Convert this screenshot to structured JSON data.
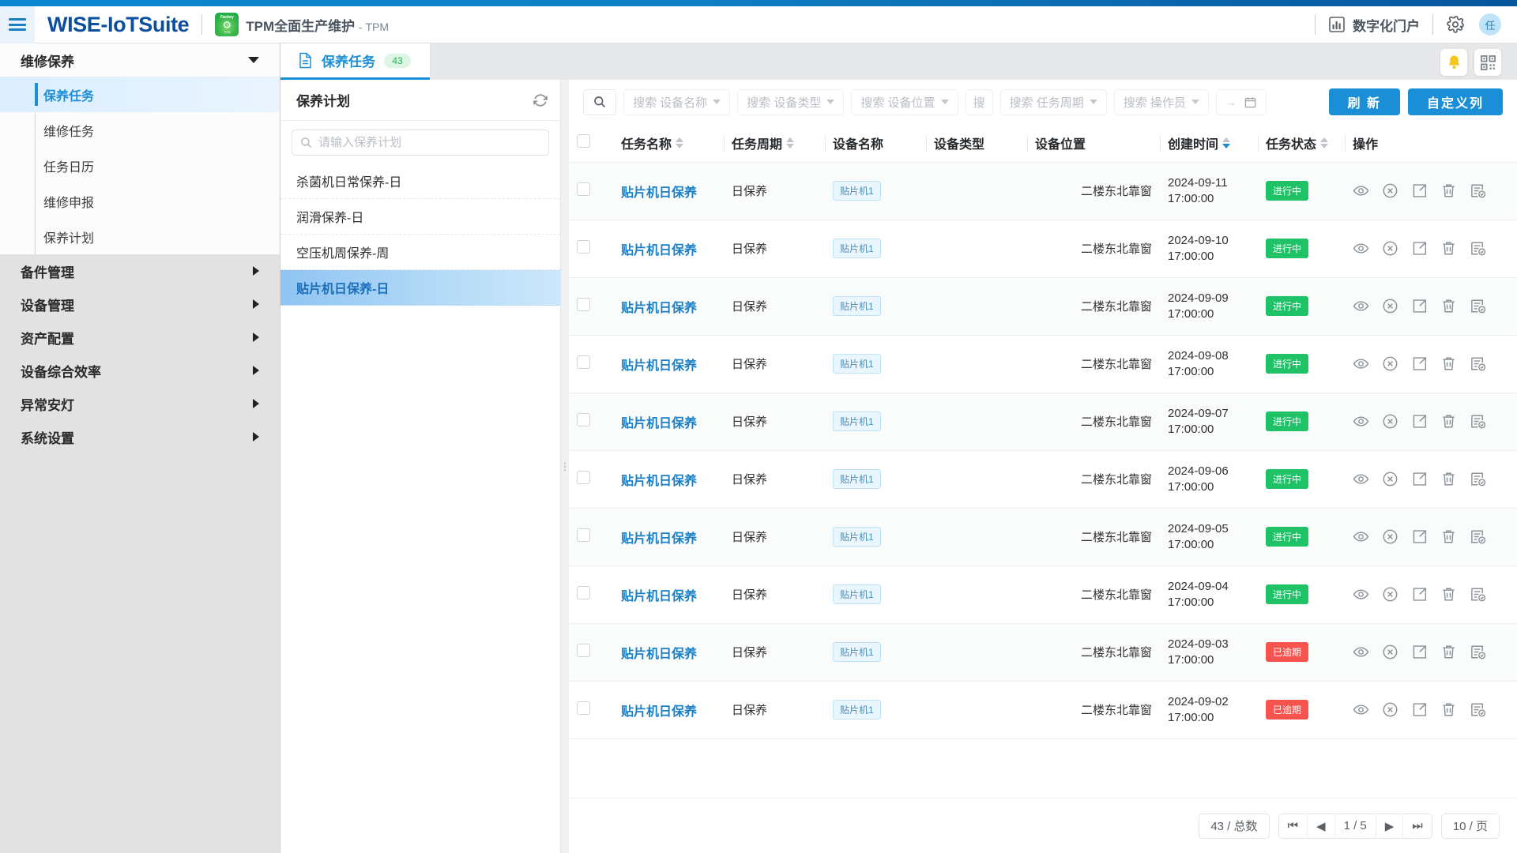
{
  "header": {
    "menu_icon": "hamburger-icon",
    "brand": "WISE-IoTSuite",
    "app_logo_top": "Factory",
    "app_logo_bottom": "TPM",
    "app_title": "TPM全面生产维护",
    "app_title_suffix": "- TPM",
    "portal_label": "数字化门户",
    "portal_icon": "chart-icon",
    "settings_icon": "gear-icon",
    "avatar_text": "任"
  },
  "sidebar": {
    "groups": [
      {
        "label": "维修保养",
        "expanded": true,
        "items": [
          {
            "label": "保养任务",
            "active": true
          },
          {
            "label": "维修任务",
            "active": false
          },
          {
            "label": "任务日历",
            "active": false
          },
          {
            "label": "维修申报",
            "active": false
          },
          {
            "label": "保养计划",
            "active": false
          }
        ]
      },
      {
        "label": "备件管理",
        "expanded": false,
        "items": []
      },
      {
        "label": "设备管理",
        "expanded": false,
        "items": []
      },
      {
        "label": "资产配置",
        "expanded": false,
        "items": []
      },
      {
        "label": "设备综合效率",
        "expanded": false,
        "items": []
      },
      {
        "label": "异常安灯",
        "expanded": false,
        "items": []
      },
      {
        "label": "系统设置",
        "expanded": false,
        "items": []
      }
    ]
  },
  "tabbar": {
    "tab_icon": "document-icon",
    "tab_label": "保养任务",
    "tab_badge": "43",
    "bell_icon": "bell-icon",
    "qr_icon": "qrcode-icon"
  },
  "plan_pane": {
    "title": "保养计划",
    "refresh_icon": "refresh-icon",
    "more_icon": "more-vertical-icon",
    "search_icon": "search-icon",
    "search_placeholder": "请输入保养计划",
    "search_value": "",
    "items": [
      {
        "label": "杀菌机日常保养-日",
        "active": false
      },
      {
        "label": "润滑保养-日",
        "active": false
      },
      {
        "label": "空压机周保养-周",
        "active": false
      },
      {
        "label": "贴片机日保养-日",
        "active": true
      }
    ]
  },
  "toolbar": {
    "search_icon": "search-icon",
    "filters": [
      {
        "label": "搜索 设备名称",
        "truncated": false
      },
      {
        "label": "搜索 设备类型",
        "truncated": false
      },
      {
        "label": "搜索 设备位置",
        "truncated": false
      },
      {
        "label": "搜",
        "truncated": true
      },
      {
        "label": "搜索 任务周期",
        "truncated": false
      },
      {
        "label": "搜索 操作员",
        "truncated": false
      }
    ],
    "daterange_icon": "calendar-icon",
    "daterange_separator": "→",
    "refresh_label": "刷 新",
    "custom_columns_label": "自定义列"
  },
  "table": {
    "select_all_checkbox": false,
    "columns": [
      {
        "label": "任务名称",
        "sortable": true,
        "sort": "none"
      },
      {
        "label": "任务周期",
        "sortable": true,
        "sort": "none"
      },
      {
        "label": "设备名称",
        "sortable": false,
        "sort": "none"
      },
      {
        "label": "设备类型",
        "sortable": false,
        "sort": "none"
      },
      {
        "label": "设备位置",
        "sortable": false,
        "sort": "none"
      },
      {
        "label": "创建时间",
        "sortable": true,
        "sort": "desc"
      },
      {
        "label": "任务状态",
        "sortable": true,
        "sort": "none"
      },
      {
        "label": "操作",
        "sortable": false,
        "sort": "none"
      }
    ],
    "row_action_icons": [
      "eye-icon",
      "circle-x-icon",
      "export-icon",
      "trash-icon",
      "form-check-icon"
    ],
    "rows": [
      {
        "checked": false,
        "task_name": "贴片机日保养",
        "cycle": "日保养",
        "device_name": "贴片机1",
        "device_type": "",
        "location": "二楼东北靠窗",
        "created_date": "2024-09-11",
        "created_time": "17:00:00",
        "status": "进行中",
        "status_kind": "running"
      },
      {
        "checked": false,
        "task_name": "贴片机日保养",
        "cycle": "日保养",
        "device_name": "贴片机1",
        "device_type": "",
        "location": "二楼东北靠窗",
        "created_date": "2024-09-10",
        "created_time": "17:00:00",
        "status": "进行中",
        "status_kind": "running"
      },
      {
        "checked": false,
        "task_name": "贴片机日保养",
        "cycle": "日保养",
        "device_name": "贴片机1",
        "device_type": "",
        "location": "二楼东北靠窗",
        "created_date": "2024-09-09",
        "created_time": "17:00:00",
        "status": "进行中",
        "status_kind": "running"
      },
      {
        "checked": false,
        "task_name": "贴片机日保养",
        "cycle": "日保养",
        "device_name": "贴片机1",
        "device_type": "",
        "location": "二楼东北靠窗",
        "created_date": "2024-09-08",
        "created_time": "17:00:00",
        "status": "进行中",
        "status_kind": "running"
      },
      {
        "checked": false,
        "task_name": "贴片机日保养",
        "cycle": "日保养",
        "device_name": "贴片机1",
        "device_type": "",
        "location": "二楼东北靠窗",
        "created_date": "2024-09-07",
        "created_time": "17:00:00",
        "status": "进行中",
        "status_kind": "running"
      },
      {
        "checked": false,
        "task_name": "贴片机日保养",
        "cycle": "日保养",
        "device_name": "贴片机1",
        "device_type": "",
        "location": "二楼东北靠窗",
        "created_date": "2024-09-06",
        "created_time": "17:00:00",
        "status": "进行中",
        "status_kind": "running"
      },
      {
        "checked": false,
        "task_name": "贴片机日保养",
        "cycle": "日保养",
        "device_name": "贴片机1",
        "device_type": "",
        "location": "二楼东北靠窗",
        "created_date": "2024-09-05",
        "created_time": "17:00:00",
        "status": "进行中",
        "status_kind": "running"
      },
      {
        "checked": false,
        "task_name": "贴片机日保养",
        "cycle": "日保养",
        "device_name": "贴片机1",
        "device_type": "",
        "location": "二楼东北靠窗",
        "created_date": "2024-09-04",
        "created_time": "17:00:00",
        "status": "进行中",
        "status_kind": "running"
      },
      {
        "checked": false,
        "task_name": "贴片机日保养",
        "cycle": "日保养",
        "device_name": "贴片机1",
        "device_type": "",
        "location": "二楼东北靠窗",
        "created_date": "2024-09-03",
        "created_time": "17:00:00",
        "status": "已逾期",
        "status_kind": "overdue"
      },
      {
        "checked": false,
        "task_name": "贴片机日保养",
        "cycle": "日保养",
        "device_name": "贴片机1",
        "device_type": "",
        "location": "二楼东北靠窗",
        "created_date": "2024-09-02",
        "created_time": "17:00:00",
        "status": "已逾期",
        "status_kind": "overdue"
      }
    ]
  },
  "pager": {
    "total_label": "43 / 总数",
    "first_icon": "first-page-icon",
    "prev_icon": "prev-page-icon",
    "page_label": "1 / 5",
    "next_icon": "next-page-icon",
    "last_icon": "last-page-icon",
    "page_size_label": "10 / 页"
  },
  "colors": {
    "brand_blue": "#0b4f9e",
    "accent_blue": "#1a8fd8",
    "status_running": "#20c267",
    "status_overdue": "#f7544f",
    "badge_green": "#2bb158"
  }
}
